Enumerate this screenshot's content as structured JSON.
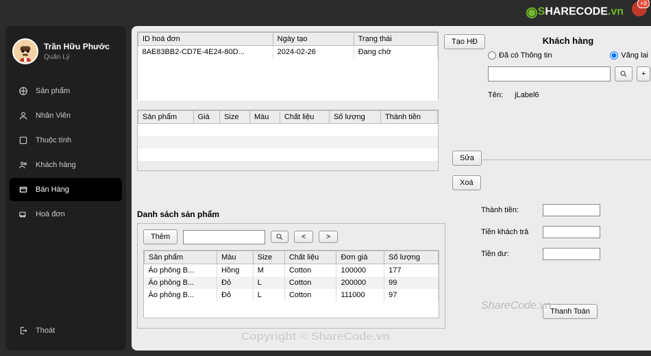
{
  "topbar": {
    "logo_prefix": "S",
    "logo_main": "HARECODE",
    "logo_suffix": ".vn",
    "badge": "+9"
  },
  "profile": {
    "name": "Trần Hữu Phước",
    "role": "Quản Lý"
  },
  "nav": {
    "items": [
      {
        "label": "Sản phẩm"
      },
      {
        "label": "Nhân Viên"
      },
      {
        "label": "Thuộc tính"
      },
      {
        "label": "Khách hàng"
      },
      {
        "label": "Bán Hàng"
      },
      {
        "label": "Hoá đơn"
      }
    ],
    "exit": "Thoát"
  },
  "invoice_table": {
    "headers": {
      "id": "ID hoá đơn",
      "date": "Ngày tạo",
      "status": "Trạng thái"
    },
    "rows": [
      {
        "id": "8AE83BB2-CD7E-4E24-80D...",
        "date": "2024-02-26",
        "status": "Đang chờ"
      }
    ]
  },
  "buttons": {
    "create": "Tạo HĐ",
    "edit": "Sửa",
    "delete": "Xoá",
    "add": "Thêm",
    "search": "🔍",
    "prev": "<",
    "next": ">",
    "plus": "+",
    "pay": "Thanh Toán"
  },
  "lines_table": {
    "headers": {
      "product": "Sản phẩm",
      "price": "Giá",
      "size": "Size",
      "color": "Màu",
      "material": "Chất liệu",
      "qty": "Số lượng",
      "total": "Thành tiền"
    }
  },
  "products": {
    "title": "Danh sách sản phẩm",
    "headers": {
      "product": "Sản phẩm",
      "color": "Màu",
      "size": "Size",
      "material": "Chất liệu",
      "unitprice": "Đơn giá",
      "qty": "Số lượng"
    },
    "rows": [
      {
        "product": "Áo phông B...",
        "color": "Hồng",
        "size": "M",
        "material": "Cotton",
        "unitprice": "100000",
        "qty": "177"
      },
      {
        "product": "Áo phông B...",
        "color": "Đỏ",
        "size": "L",
        "material": "Cotton",
        "unitprice": "200000",
        "qty": "99"
      },
      {
        "product": "Áo phông B...",
        "color": "Đỏ",
        "size": "L",
        "material": "Cotton",
        "unitprice": "111000",
        "qty": "97"
      }
    ]
  },
  "customer": {
    "title": "Khách hàng",
    "radio_existing": "Đã có Thông tin",
    "radio_guest": "Vãng lai",
    "name_label": "Tên:",
    "name_value": "jLabel6"
  },
  "totals": {
    "subtotal_label": "Thành tiền:",
    "paid_label": "Tiền khách trả",
    "change_label": "Tiền dư:"
  },
  "watermarks": {
    "w1": "ShareCode.vn",
    "w2": "Copyright © ShareCode.vn"
  }
}
